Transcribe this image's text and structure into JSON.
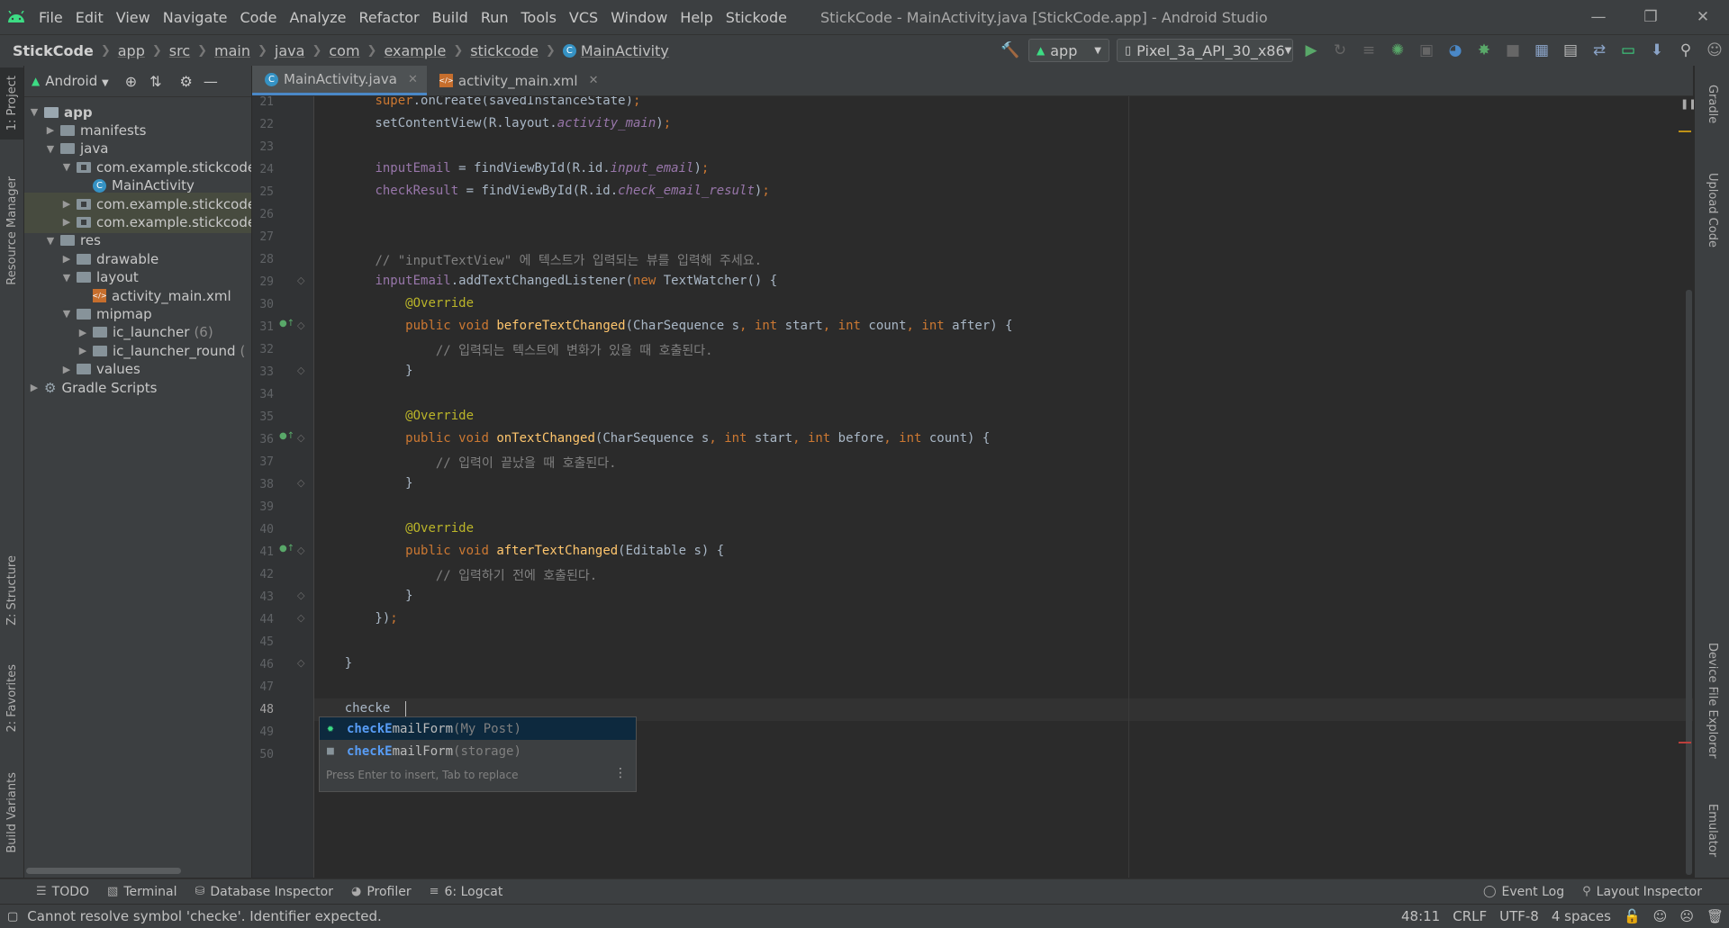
{
  "app": {
    "title": "StickCode - MainActivity.java [StickCode.app] - Android Studio"
  },
  "menu": [
    "File",
    "Edit",
    "View",
    "Navigate",
    "Code",
    "Analyze",
    "Refactor",
    "Build",
    "Run",
    "Tools",
    "VCS",
    "Window",
    "Help",
    "Stickode"
  ],
  "breadcrumb": [
    "StickCode",
    "app",
    "src",
    "main",
    "java",
    "com",
    "example",
    "stickcode",
    "MainActivity"
  ],
  "toolbar": {
    "run_config": "app",
    "device": "Pixel_3a_API_30_x86"
  },
  "left_stripe": [
    "1: Project",
    "Resource Manager",
    "Z: Structure",
    "2: Favorites",
    "Build Variants"
  ],
  "project": {
    "view_mode": "Android",
    "tree": [
      {
        "label": "app",
        "depth": 0,
        "kind": "module",
        "open": true
      },
      {
        "label": "manifests",
        "depth": 1,
        "kind": "folder",
        "open": false
      },
      {
        "label": "java",
        "depth": 1,
        "kind": "folder",
        "open": true
      },
      {
        "label": "com.example.stickcode",
        "depth": 2,
        "kind": "package",
        "open": true
      },
      {
        "label": "MainActivity",
        "depth": 3,
        "kind": "class"
      },
      {
        "label": "com.example.stickcode",
        "depth": 2,
        "kind": "package",
        "open": false,
        "sel": true
      },
      {
        "label": "com.example.stickcode",
        "depth": 2,
        "kind": "package",
        "open": false,
        "sel": true
      },
      {
        "label": "res",
        "depth": 1,
        "kind": "folder",
        "open": true
      },
      {
        "label": "drawable",
        "depth": 2,
        "kind": "folder",
        "open": false
      },
      {
        "label": "layout",
        "depth": 2,
        "kind": "folder",
        "open": true
      },
      {
        "label": "activity_main.xml",
        "depth": 3,
        "kind": "xml"
      },
      {
        "label": "mipmap",
        "depth": 2,
        "kind": "folder",
        "open": true
      },
      {
        "label": "ic_launcher",
        "count": "(6)",
        "depth": 3,
        "kind": "folder",
        "open": false
      },
      {
        "label": "ic_launcher_round",
        "count": "(",
        "depth": 3,
        "kind": "folder",
        "open": false
      },
      {
        "label": "values",
        "depth": 2,
        "kind": "folder",
        "open": false
      },
      {
        "label": "Gradle Scripts",
        "depth": 0,
        "kind": "gradle",
        "open": false
      }
    ]
  },
  "tabs": [
    {
      "label": "MainActivity.java",
      "active": true
    },
    {
      "label": "activity_main.xml",
      "active": false
    }
  ],
  "editor": {
    "current_line": "48",
    "lines": [
      {
        "n": "21",
        "html": "        <span class=\"kw\">super</span>.onCreate(savedInstanceState)<span class=\"kw\">;</span>"
      },
      {
        "n": "22",
        "html": "        setContentView(R.layout.<span class=\"fi\">activity_main</span>)<span class=\"kw\">;</span>"
      },
      {
        "n": "23",
        "html": ""
      },
      {
        "n": "24",
        "html": "        <span class=\"fld\">inputEmail</span> = findViewById(R.id.<span class=\"fi\">input_email</span>)<span class=\"kw\">;</span>"
      },
      {
        "n": "25",
        "html": "        <span class=\"fld\">checkResult</span> = findViewById(R.id.<span class=\"fi\">check_email_result</span>)<span class=\"kw\">;</span>"
      },
      {
        "n": "26",
        "html": ""
      },
      {
        "n": "27",
        "html": ""
      },
      {
        "n": "28",
        "html": "        <span class=\"cm\">// \"inputTextView\" 에 텍스트가 입력되는 뷰를 입력해 주세요.</span>"
      },
      {
        "n": "29",
        "html": "        <span class=\"fld\">inputEmail</span>.addTextChangedListener(<span class=\"kw\">new</span> TextWatcher() {"
      },
      {
        "n": "30",
        "html": "            <span class=\"ann\">@Override</span>"
      },
      {
        "n": "31",
        "html": "            <span class=\"kw\">public void</span> <span class=\"mth\">beforeTextChanged</span>(CharSequence s<span class=\"kw\">,</span> <span class=\"kw\">int</span> start<span class=\"kw\">,</span> <span class=\"kw\">int</span> count<span class=\"kw\">,</span> <span class=\"kw\">int</span> after) {"
      },
      {
        "n": "32",
        "html": "                <span class=\"cm\">// 입력되는 텍스트에 변화가 있을 때 호출된다.</span>"
      },
      {
        "n": "33",
        "html": "            }"
      },
      {
        "n": "34",
        "html": ""
      },
      {
        "n": "35",
        "html": "            <span class=\"ann\">@Override</span>"
      },
      {
        "n": "36",
        "html": "            <span class=\"kw\">public void</span> <span class=\"mth\">onTextChanged</span>(CharSequence s<span class=\"kw\">,</span> <span class=\"kw\">int</span> start<span class=\"kw\">,</span> <span class=\"kw\">int</span> before<span class=\"kw\">,</span> <span class=\"kw\">int</span> count) {"
      },
      {
        "n": "37",
        "html": "                <span class=\"cm\">// 입력이 끝났을 때 호출된다.</span>"
      },
      {
        "n": "38",
        "html": "            }"
      },
      {
        "n": "39",
        "html": ""
      },
      {
        "n": "40",
        "html": "            <span class=\"ann\">@Override</span>"
      },
      {
        "n": "41",
        "html": "            <span class=\"kw\">public void</span> <span class=\"mth\">afterTextChanged</span>(Editable s) {"
      },
      {
        "n": "42",
        "html": "                <span class=\"cm\">// 입력하기 전에 호출된다.</span>"
      },
      {
        "n": "43",
        "html": "            }"
      },
      {
        "n": "44",
        "html": "        })<span class=\"kw\">;</span>"
      },
      {
        "n": "45",
        "html": ""
      },
      {
        "n": "46",
        "html": "    }"
      },
      {
        "n": "47",
        "html": ""
      },
      {
        "n": "48",
        "html": "    checke"
      },
      {
        "n": "49",
        "html": ""
      },
      {
        "n": "50",
        "html": ""
      }
    ],
    "override_markers": [
      "31",
      "36",
      "41"
    ]
  },
  "completion": {
    "items": [
      {
        "match": "checkE",
        "rest": "mailForm",
        "source": "(My Post)",
        "icon": "stickode-icon"
      },
      {
        "match": "checkE",
        "rest": "mailForm",
        "source": "(storage)",
        "icon": "folder-icon"
      }
    ],
    "hint": "Press Enter to insert, Tab to replace"
  },
  "right_stripe": [
    "Gradle",
    "Upload Code",
    "Device File Explorer",
    "Emulator"
  ],
  "bottom_tools": {
    "left": [
      "TODO",
      "Terminal",
      "Database Inspector",
      "Profiler",
      "6: Logcat"
    ],
    "right": [
      "Event Log",
      "Layout Inspector"
    ]
  },
  "status": {
    "message": "Cannot resolve symbol 'checke'. Identifier expected.",
    "position": "48:11",
    "line_sep": "CRLF",
    "encoding": "UTF-8",
    "indent": "4 spaces"
  },
  "colors": {
    "accent": "#4a88c7",
    "android_green": "#3ddc84",
    "run_green": "#59a869"
  }
}
